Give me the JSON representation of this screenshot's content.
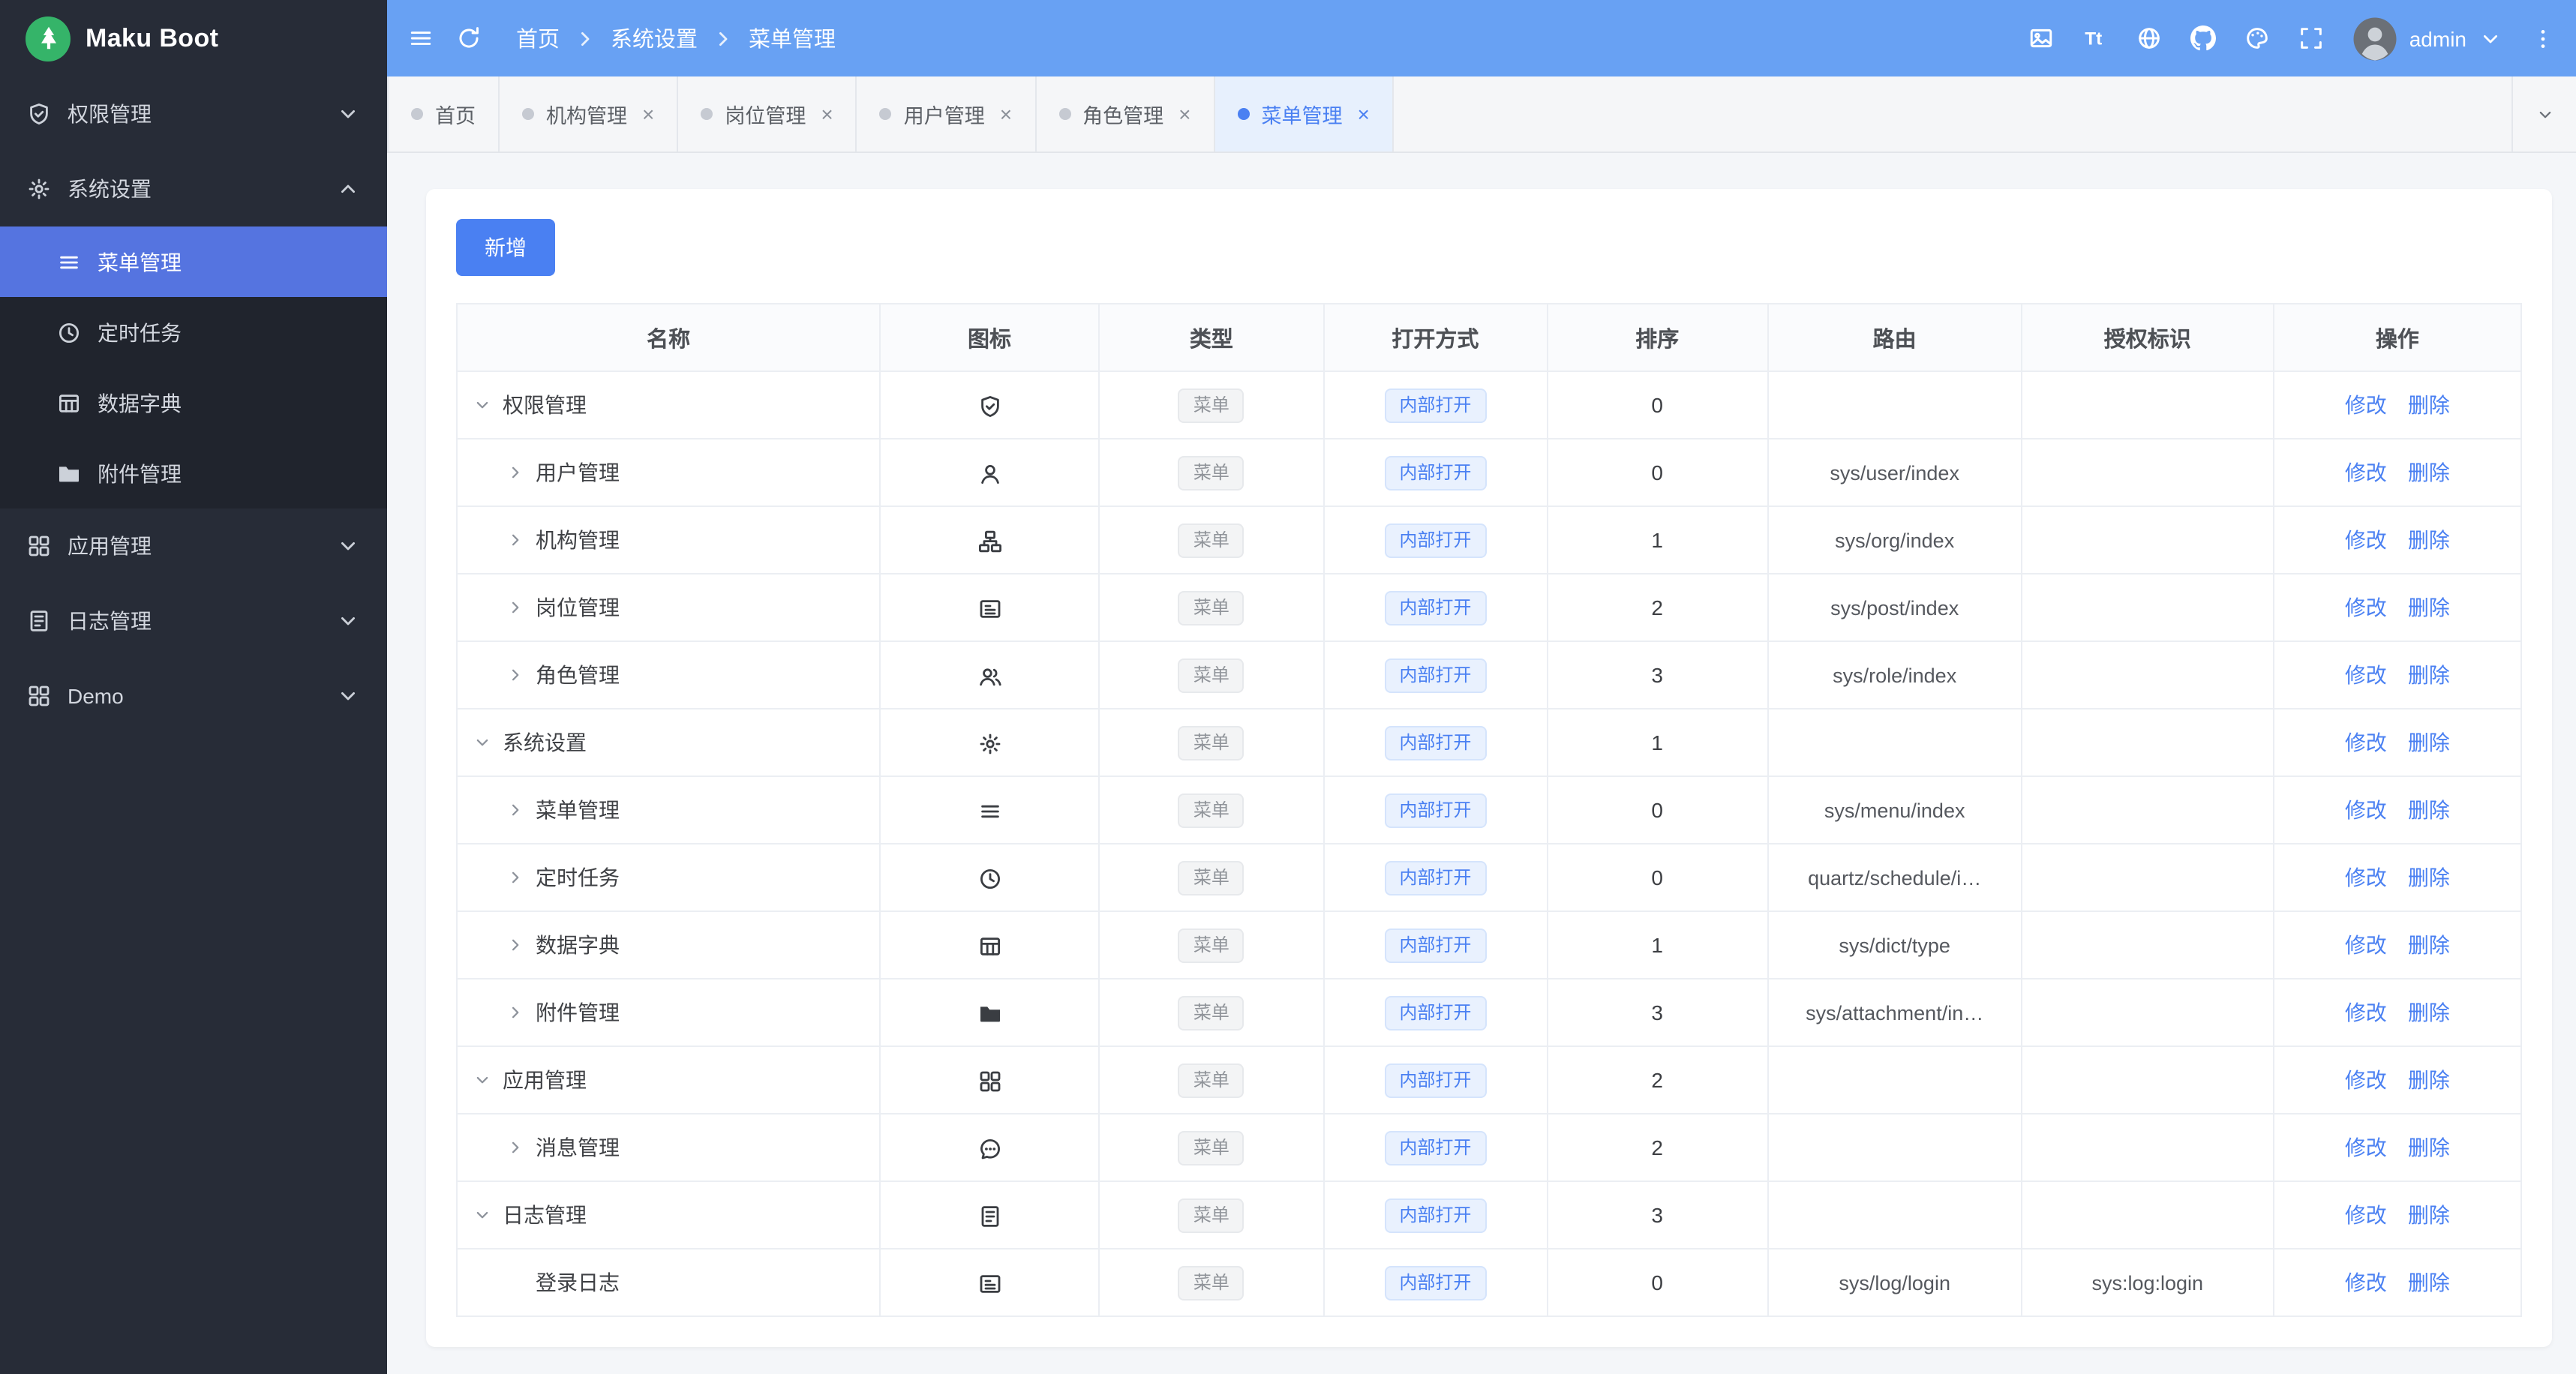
{
  "colors": {
    "header_blue": "#68a1f3",
    "primary_blue": "#4a80f2",
    "sidebar_active_blue": "#5574e0",
    "sidebar_bg": "#272c37",
    "logo_green": "#35b469"
  },
  "sidebar": {
    "logo_text": "Maku Boot",
    "logo_icon": "tree-icon",
    "items": [
      {
        "label": "权限管理",
        "icon": "shield-icon",
        "expanded": false
      },
      {
        "label": "系统设置",
        "icon": "gear-icon",
        "expanded": true,
        "children": [
          {
            "label": "菜单管理",
            "icon": "menu-lines-icon",
            "active": true
          },
          {
            "label": "定时任务",
            "icon": "clock-icon",
            "active": false
          },
          {
            "label": "数据字典",
            "icon": "grid-table-icon",
            "active": false
          },
          {
            "label": "附件管理",
            "icon": "folder-icon",
            "active": false
          }
        ]
      },
      {
        "label": "应用管理",
        "icon": "apps-icon",
        "expanded": false
      },
      {
        "label": "日志管理",
        "icon": "log-doc-icon",
        "expanded": false
      },
      {
        "label": "Demo",
        "icon": "apps-icon",
        "expanded": false
      }
    ]
  },
  "header": {
    "breadcrumb": [
      "首页",
      "系统设置",
      "菜单管理"
    ],
    "actions": [
      "screenshot-icon",
      "font-size-icon",
      "globe-icon",
      "github-icon",
      "theme-icon",
      "fullscreen-icon"
    ],
    "user": {
      "name": "admin"
    }
  },
  "tabs": {
    "items": [
      {
        "label": "首页",
        "closable": false,
        "active": false
      },
      {
        "label": "机构管理",
        "closable": true,
        "active": false
      },
      {
        "label": "岗位管理",
        "closable": true,
        "active": false
      },
      {
        "label": "用户管理",
        "closable": true,
        "active": false
      },
      {
        "label": "角色管理",
        "closable": true,
        "active": false
      },
      {
        "label": "菜单管理",
        "closable": true,
        "active": true
      }
    ]
  },
  "toolbar": {
    "add_label": "新增"
  },
  "table": {
    "columns": [
      "名称",
      "图标",
      "类型",
      "打开方式",
      "排序",
      "路由",
      "授权标识",
      "操作"
    ],
    "tag_type_label": "菜单",
    "tag_open_label": "内部打开",
    "op_labels": [
      "修改",
      "删除"
    ],
    "rows": [
      {
        "name": "权限管理",
        "level": 0,
        "expand": "down",
        "icon": "shield-icon",
        "sort": "0",
        "route": "",
        "auth": ""
      },
      {
        "name": "用户管理",
        "level": 1,
        "expand": "right",
        "icon": "user-icon",
        "sort": "0",
        "route": "sys/user/index",
        "auth": ""
      },
      {
        "name": "机构管理",
        "level": 1,
        "expand": "right",
        "icon": "org-icon",
        "sort": "1",
        "route": "sys/org/index",
        "auth": ""
      },
      {
        "name": "岗位管理",
        "level": 1,
        "expand": "right",
        "icon": "badge-icon",
        "sort": "2",
        "route": "sys/post/index",
        "auth": ""
      },
      {
        "name": "角色管理",
        "level": 1,
        "expand": "right",
        "icon": "users-icon",
        "sort": "3",
        "route": "sys/role/index",
        "auth": ""
      },
      {
        "name": "系统设置",
        "level": 0,
        "expand": "down",
        "icon": "gear-icon",
        "sort": "1",
        "route": "",
        "auth": ""
      },
      {
        "name": "菜单管理",
        "level": 1,
        "expand": "right",
        "icon": "menu-lines-icon",
        "sort": "0",
        "route": "sys/menu/index",
        "auth": ""
      },
      {
        "name": "定时任务",
        "level": 1,
        "expand": "right",
        "icon": "clock-icon",
        "sort": "0",
        "route": "quartz/schedule/i…",
        "auth": ""
      },
      {
        "name": "数据字典",
        "level": 1,
        "expand": "right",
        "icon": "grid-table-icon",
        "sort": "1",
        "route": "sys/dict/type",
        "auth": ""
      },
      {
        "name": "附件管理",
        "level": 1,
        "expand": "right",
        "icon": "folder-icon",
        "sort": "3",
        "route": "sys/attachment/in…",
        "auth": ""
      },
      {
        "name": "应用管理",
        "level": 0,
        "expand": "down",
        "icon": "apps-icon",
        "sort": "2",
        "route": "",
        "auth": ""
      },
      {
        "name": "消息管理",
        "level": 1,
        "expand": "right",
        "icon": "message-icon",
        "sort": "2",
        "route": "",
        "auth": ""
      },
      {
        "name": "日志管理",
        "level": 0,
        "expand": "down",
        "icon": "log-doc-icon",
        "sort": "3",
        "route": "",
        "auth": ""
      },
      {
        "name": "登录日志",
        "level": 1,
        "expand": "none",
        "icon": "badge-icon",
        "sort": "0",
        "route": "sys/log/login",
        "auth": "sys:log:login"
      }
    ]
  }
}
